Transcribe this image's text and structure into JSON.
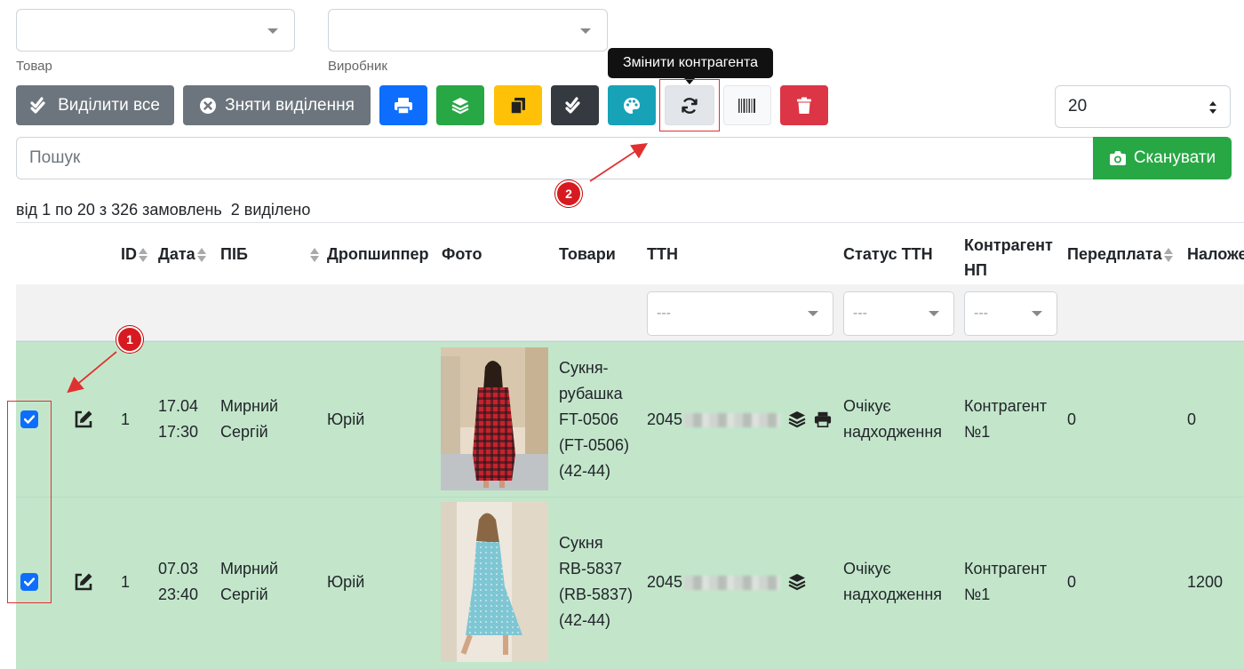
{
  "filters": {
    "product_label": "Товар",
    "manufacturer_label": "Виробник"
  },
  "toolbar": {
    "select_all_label": "Виділити все",
    "deselect_label": "Зняти виділення",
    "tooltip": "Змінити контрагента",
    "per_page": "20"
  },
  "search": {
    "placeholder": "Пошук",
    "scan_label": "Сканувати"
  },
  "summary": "від 1 по 20 з 326 замовлень  2 виділено",
  "table": {
    "headers": {
      "id": "ID",
      "date": "Дата",
      "name": "ПІБ",
      "dropshipper": "Дропшиппер",
      "photo": "Фото",
      "goods": "Товари",
      "ttn": "ТТН",
      "ttn_status": "Статус ТТН",
      "counterparty": "Контрагент НП",
      "prepayment": "Передплата",
      "cod": "Наложе"
    },
    "filter_placeholder": "---",
    "rows": [
      {
        "id": "1",
        "date": "17.04",
        "time": "17:30",
        "name_first": "Мирний",
        "name_last": "Сергій",
        "dropshipper": "Юрій",
        "goods": [
          "Сукня-",
          "рубашка",
          "FT-0506",
          "(FT-0506)",
          "(42-44)"
        ],
        "ttn_prefix": "2045",
        "status": [
          "Очікує",
          "надходження"
        ],
        "counterparty": [
          "Контрагент",
          "№1"
        ],
        "prepayment": "0",
        "cod": "0",
        "checked": true
      },
      {
        "id": "1",
        "date": "07.03",
        "time": "23:40",
        "name_first": "Мирний",
        "name_last": "Сергій",
        "dropshipper": "Юрій",
        "goods": [
          "Сукня",
          "RB-5837",
          "(RB-5837)",
          "(42-44)"
        ],
        "ttn_prefix": "2045",
        "status": [
          "Очікує",
          "надходження"
        ],
        "counterparty": [
          "Контрагент",
          "№1"
        ],
        "prepayment": "0",
        "cod": "1200",
        "checked": true
      }
    ]
  },
  "annotations": {
    "step1": "1",
    "step2": "2"
  },
  "colors": {
    "selected_row": "#c3e6cb",
    "annotation_red": "#e03131"
  }
}
